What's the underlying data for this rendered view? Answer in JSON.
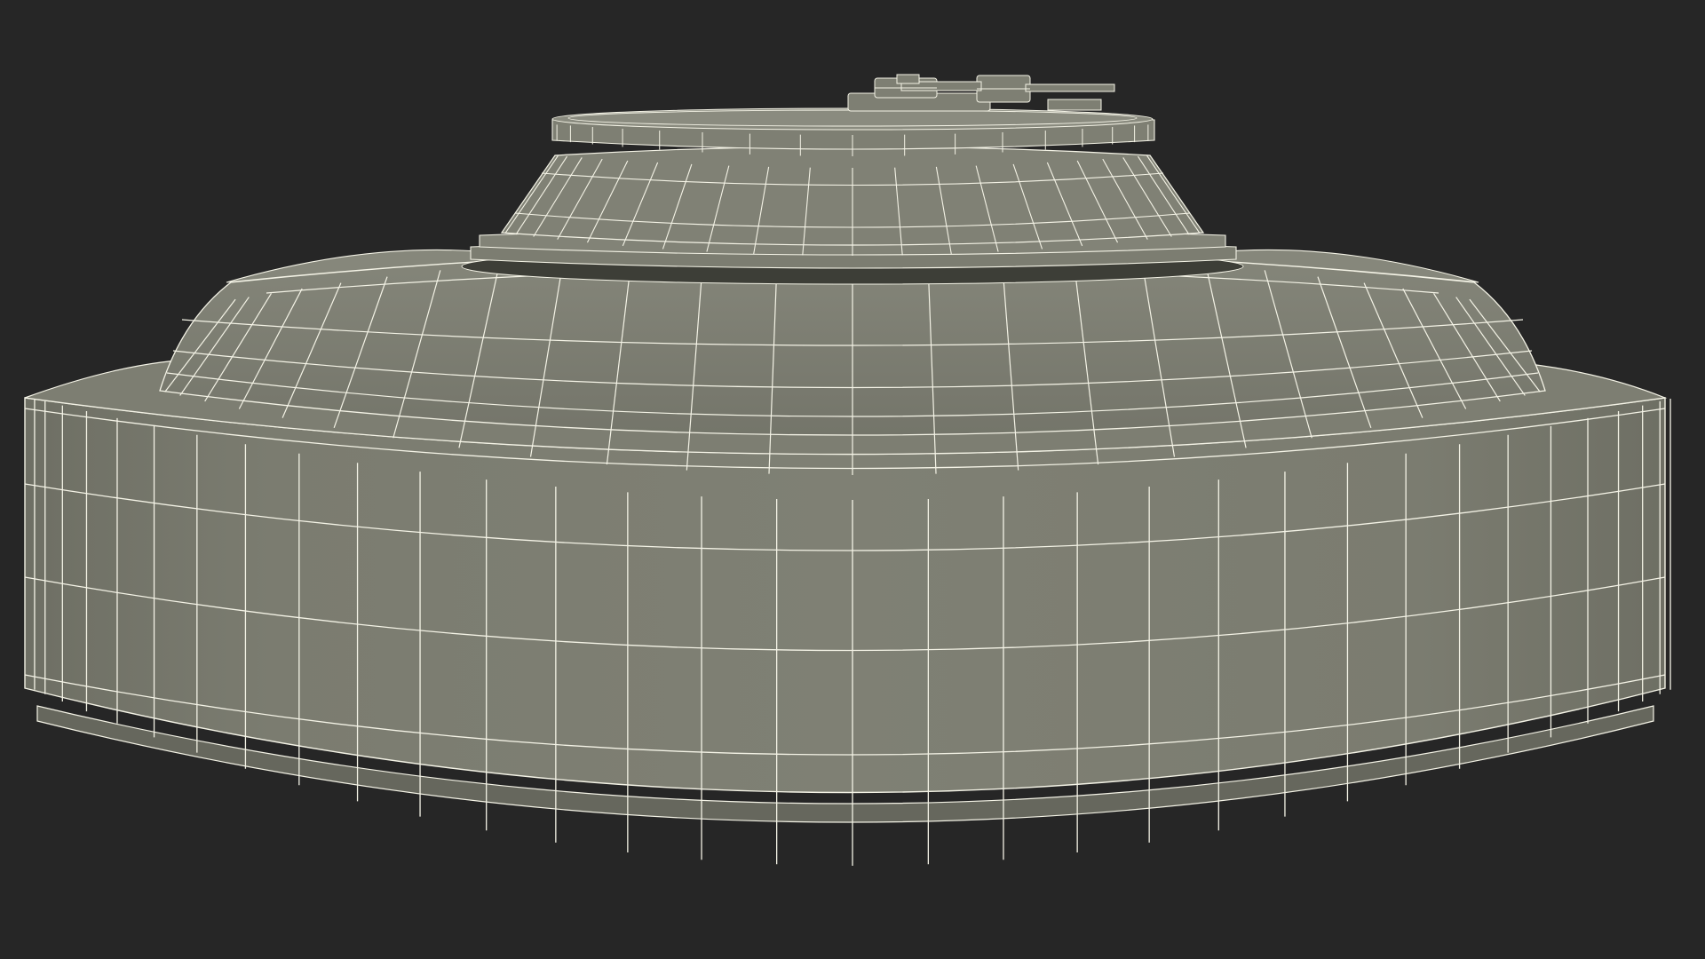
{
  "scene": {
    "subject": "wireframe-3d-model",
    "background_color": "#262626",
    "surface_color": "#7b7c70",
    "surface_dark_color": "#5d5e54",
    "surface_light_color": "#8b8c80",
    "wire_color": "#f4f3e6"
  }
}
